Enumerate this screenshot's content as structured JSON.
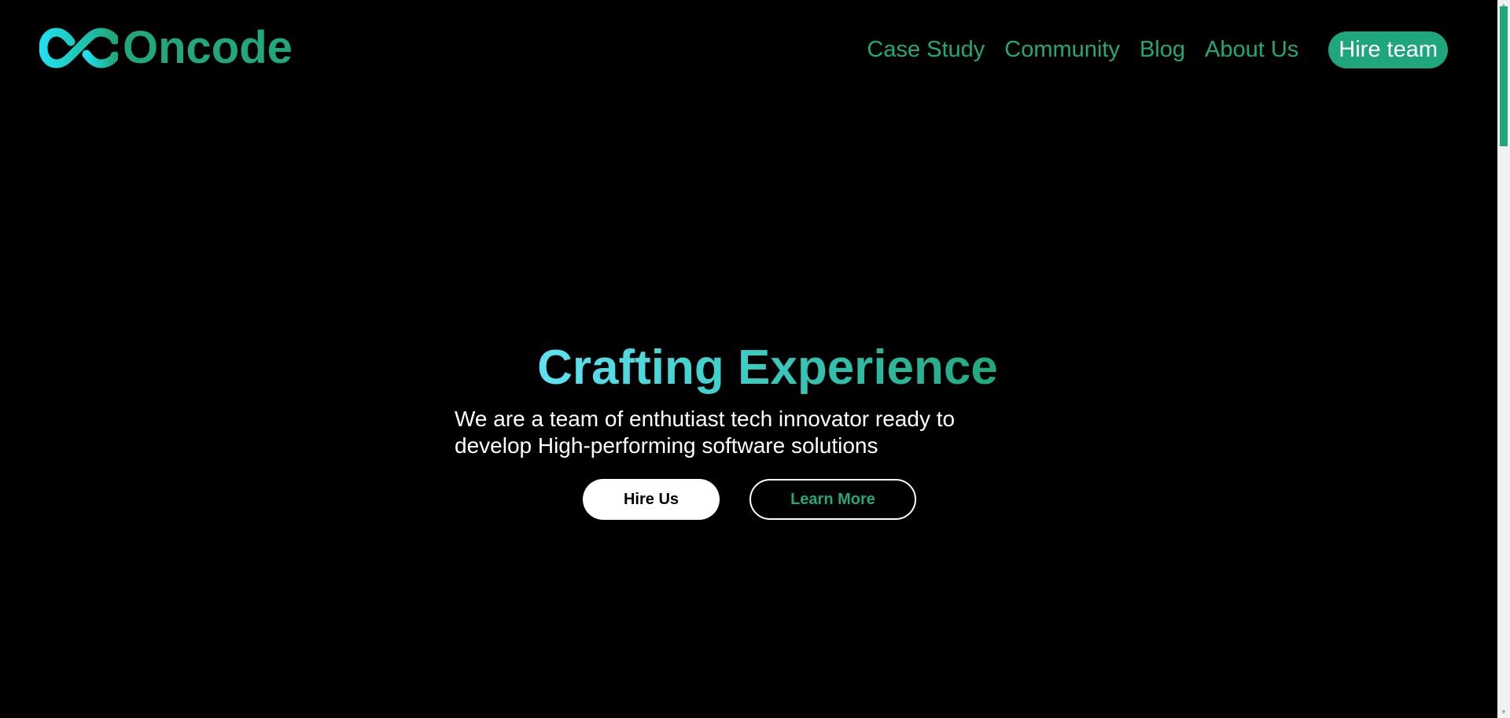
{
  "header": {
    "logo_text": "Oncode",
    "nav": [
      {
        "label": "Case Study"
      },
      {
        "label": "Community"
      },
      {
        "label": "Blog"
      },
      {
        "label": "About Us"
      }
    ],
    "cta_label": "Hire team"
  },
  "hero": {
    "title": "Crafting Experience",
    "subtitle_line1": "We are a team of enthutiast tech innovator ready to",
    "subtitle_line2": "develop High-performing software solutions",
    "primary_button": "Hire Us",
    "secondary_button": "Learn More"
  },
  "colors": {
    "background": "#000000",
    "brand_green": "#20a77c",
    "brand_cyan": "#5fe3f4",
    "white": "#ffffff"
  },
  "icons": {
    "logo": "infinity-logo-icon",
    "scroll_up": "scroll-up-arrow-icon",
    "scroll_down": "scroll-down-arrow-icon"
  }
}
